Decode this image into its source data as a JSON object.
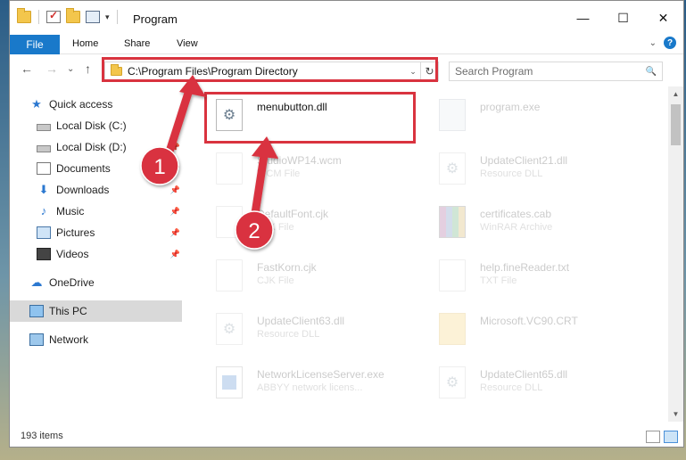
{
  "window": {
    "title": "Program",
    "controls": {
      "minimize": "—",
      "maximize": "☐",
      "close": "✕"
    }
  },
  "ribbon": {
    "tabs": [
      "File",
      "Home",
      "Share",
      "View"
    ],
    "help": "?",
    "collapse": "⌄"
  },
  "nav": {
    "back": "←",
    "forward": "→",
    "recent": "⌄",
    "up": "↑",
    "address": "C:\\Program Files\\Program Directory",
    "address_dropdown": "⌄",
    "refresh": "↻",
    "search_placeholder": "Search Program",
    "search_icon": "🔍"
  },
  "sidebar": {
    "items": [
      {
        "label": "Quick access",
        "icon": "star-icon",
        "pinned": false,
        "selected": false
      },
      {
        "label": "Local Disk (C:)",
        "icon": "drive-icon",
        "pinned": false,
        "selected": false
      },
      {
        "label": "Local Disk (D:)",
        "icon": "drive-icon",
        "pinned": true,
        "selected": false
      },
      {
        "label": "Documents",
        "icon": "documents-icon",
        "pinned": true,
        "selected": false
      },
      {
        "label": "Downloads",
        "icon": "download-icon",
        "pinned": true,
        "selected": false
      },
      {
        "label": "Music",
        "icon": "music-icon",
        "pinned": true,
        "selected": false
      },
      {
        "label": "Pictures",
        "icon": "pictures-icon",
        "pinned": true,
        "selected": false
      },
      {
        "label": "Videos",
        "icon": "videos-icon",
        "pinned": true,
        "selected": false
      },
      {
        "label": "OneDrive",
        "icon": "cloud-icon",
        "pinned": false,
        "selected": false
      },
      {
        "label": "This PC",
        "icon": "computer-icon",
        "pinned": false,
        "selected": true
      },
      {
        "label": "Network",
        "icon": "network-icon",
        "pinned": false,
        "selected": false
      }
    ],
    "pin_glyph": "📌"
  },
  "files": [
    {
      "name": "menubutton.dll",
      "type": "",
      "icon": "dll-icon",
      "faded": false
    },
    {
      "name": "program.exe",
      "type": "",
      "icon": "exe-icon",
      "faded": true
    },
    {
      "name": "StudioWP14.wcm",
      "type": "WCM File",
      "icon": "document-icon",
      "faded": true
    },
    {
      "name": "UpdateClient21.dll",
      "type": "Resource DLL",
      "icon": "dll-icon",
      "faded": true
    },
    {
      "name": "DefaultFont.cjk",
      "type": "CJK File",
      "icon": "document-icon",
      "faded": true
    },
    {
      "name": "certificates.cab",
      "type": "WinRAR Archive",
      "icon": "archive-icon",
      "faded": true
    },
    {
      "name": "FastKorn.cjk",
      "type": "CJK File",
      "icon": "document-icon",
      "faded": true
    },
    {
      "name": "help.fineReader.txt",
      "type": "TXT File",
      "icon": "document-icon",
      "faded": true
    },
    {
      "name": "UpdateClient63.dll",
      "type": "Resource DLL",
      "icon": "dll-icon",
      "faded": true
    },
    {
      "name": "Microsoft.VC90.CRT",
      "type": "",
      "icon": "folder-icon",
      "faded": true
    },
    {
      "name": "NetworkLicenseServer.exe",
      "type": "ABBYY network licens...",
      "icon": "app-icon",
      "faded": true
    },
    {
      "name": "UpdateClient65.dll",
      "type": "Resource DLL",
      "icon": "dll-icon",
      "faded": true
    }
  ],
  "status": {
    "item_count": "193 items"
  },
  "annotations": {
    "step1": "1",
    "step2": "2",
    "color": "#d9333f"
  }
}
